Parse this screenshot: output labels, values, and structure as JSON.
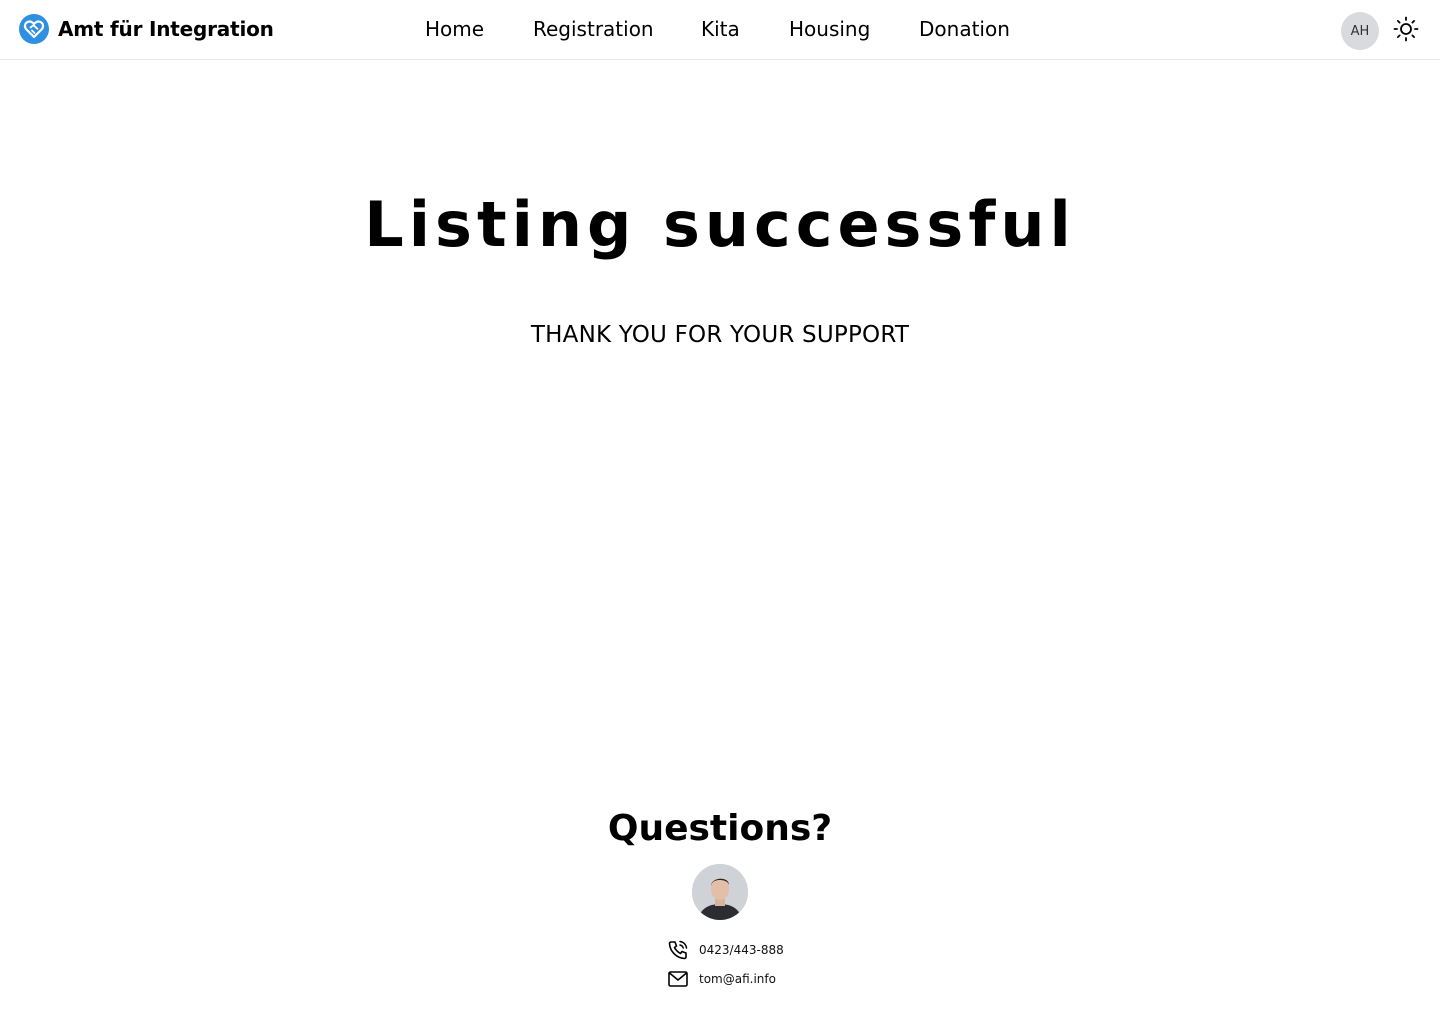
{
  "app": {
    "name": "Amt für Integration",
    "brand_color": "#2f8fe0",
    "logo_icon": "heart-handshake-icon"
  },
  "nav": {
    "items": [
      {
        "label": "Home"
      },
      {
        "label": "Registration"
      },
      {
        "label": "Kita"
      },
      {
        "label": "Housing"
      },
      {
        "label": "Donation"
      }
    ]
  },
  "header_right": {
    "user_initials": "AH",
    "theme_icon": "sun-icon"
  },
  "main": {
    "title": "Listing successful",
    "subtitle": "THANK YOU FOR YOUR SUPPORT"
  },
  "contact": {
    "heading": "Questions?",
    "phone": "0423/443-888",
    "email": "tom@afi.info",
    "phone_icon": "phone-icon",
    "email_icon": "mail-icon"
  }
}
